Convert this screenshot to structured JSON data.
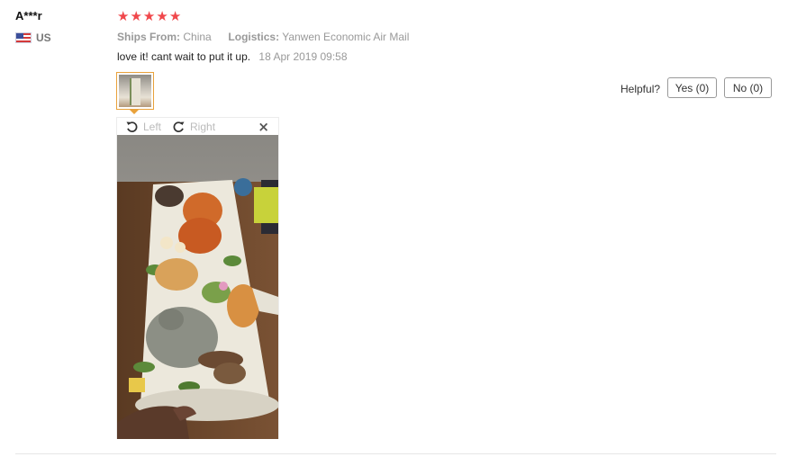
{
  "review": {
    "user_name": "A***r",
    "country": "US",
    "rating": 5,
    "stars": [
      "★",
      "★",
      "★",
      "★",
      "★"
    ],
    "ships_from_label": "Ships From:",
    "ships_from_value": "China",
    "logistics_label": "Logistics:",
    "logistics_value": "Yanwen Economic Air Mail",
    "feedback_text": "love it! cant wait to put it up.",
    "date": "18 Apr 2019 09:58"
  },
  "helpful": {
    "label": "Helpful?",
    "yes_label": "Yes (0)",
    "no_label": "No (0)"
  },
  "viewer": {
    "rotate_left_label": "Left",
    "rotate_right_label": "Right",
    "close_glyph": "×"
  },
  "colors": {
    "star": "#f0474b",
    "thumb_border": "#e9a23b",
    "muted_text": "#999999"
  }
}
